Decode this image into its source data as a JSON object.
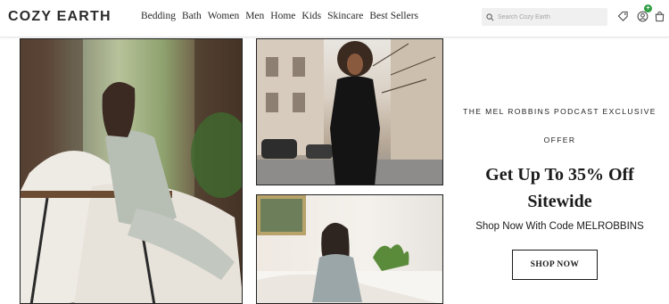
{
  "header": {
    "logo": "COZY EARTH",
    "nav": [
      "Bedding",
      "Bath",
      "Women",
      "Men",
      "Home",
      "Kids",
      "Skincare",
      "Best Sellers"
    ],
    "search": {
      "placeholder": "Search Cozy Earth",
      "icon": "search-icon"
    },
    "icons": [
      "tag-icon",
      "account-icon",
      "cart-icon"
    ],
    "cart_badge": "+",
    "badge_color": "#2f9e44"
  },
  "promo": {
    "eyebrow_line1": "THE MEL ROBBINS PODCAST EXCLUSIVE",
    "eyebrow_line2": "OFFER",
    "headline_line1": "Get Up To 35% Off",
    "headline_line2": "Sitewide",
    "code_text": "Shop Now With Code MELROBBINS",
    "cta_label": "SHOP NOW"
  }
}
